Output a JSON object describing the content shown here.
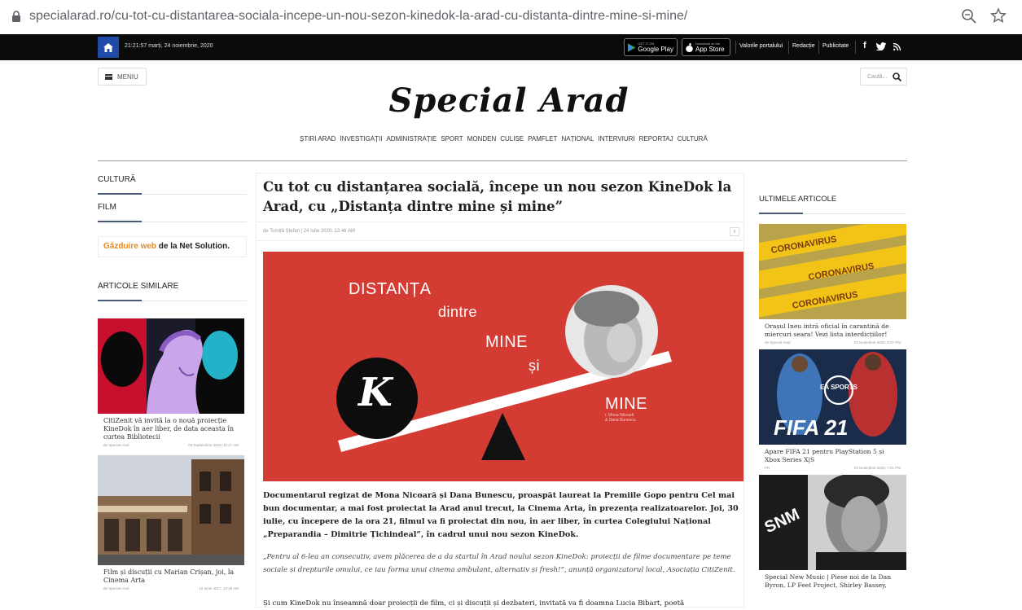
{
  "browser": {
    "url": "specialarad.ro/cu-tot-cu-distantarea-sociala-incepe-un-nou-sezon-kinedok-la-arad-cu-distanta-dintre-mine-si-mine/",
    "icons": [
      "lock-icon",
      "zoom-icon",
      "star-icon"
    ]
  },
  "topbar": {
    "datetime": "21:21:57 marți, 24 noiembrie, 2020",
    "google_play_small": "GET IT ON",
    "google_play": "Google Play",
    "app_store_small": "Download on the",
    "app_store": "App Store",
    "links": [
      "Valorile portalului",
      "Redacție",
      "Publicitate"
    ],
    "social": [
      "facebook-icon",
      "twitter-icon",
      "rss-icon"
    ]
  },
  "header": {
    "menu_label": "MENIU",
    "search_placeholder": "Caută...",
    "logo": "Special Arad",
    "nav": [
      "ȘTIRI ARAD",
      "INVESTIGAȚII",
      "ADMINISTRAȚIE",
      "SPORT",
      "MONDEN",
      "CULISE",
      "PAMFLET",
      "NAȚIONAL",
      "INTERVIURI",
      "REPORTAJ",
      "CULTURĂ"
    ]
  },
  "left": {
    "categories": [
      "CULTURĂ",
      "FILM"
    ],
    "hosting_highlight": "Găzduire web",
    "hosting_rest": " de la Net Solution.",
    "related_title": "ARTICOLE SIMILARE",
    "related": [
      {
        "title": "CitiZenit vă invită la o nouă proiecție KineDok în aer liber, de data aceasta în curtea Bibliotecii",
        "author": "de Special Arad",
        "date": "03 Septembrie 2019, 11:27 AM"
      },
      {
        "title": "Film și discuții cu Marian Crișan, joi, la Cinema Arta",
        "author": "de Special Arad",
        "date": "10 Iunie 2017, 10:28 AM"
      }
    ]
  },
  "article": {
    "title": "Cu tot cu distanțarea socială, începe un nou sezon KineDok la Arad, cu „Distanța dintre mine și mine”",
    "meta": "de Tomiță Ștefan | 24 Iulie 2020, 13:46 AM",
    "comments": "0",
    "hero": {
      "line1": "DISTANȚA",
      "line2": "dintre",
      "line3": "MINE",
      "line4": "și",
      "line5": "MINE",
      "credit1": "r. Mona Nicoară",
      "credit2": "& Dana Bunescu",
      "logo_glyph": "K"
    },
    "p1": "Documentarul regizat de Mona Nicoară și Dana Bunescu, proaspăt laureat la Premiile Gopo pentru Cel mai bun documentar, a mai fost proiectat la Arad anul trecut, la Cinema Arta, în prezența realizatoarelor. Joi, 30 iulie, cu începere de la ora 21, filmul va fi proiectat din nou, în aer liber, în curtea Colegiului Național „Preparandia – Dimitrie Țichindeal”, în cadrul unui nou sezon KineDok.",
    "p2": "„Pentru al 6-lea an consecutiv, avem plăcerea de a da startul în Arad noului sezon KineDok: proiecții de filme documentare pe teme sociale și drepturile omului, ce iau forma unui cinema ambulant, alternativ și fresh!”, anunță organizatorul local, Asociația CitiZenit.",
    "p3": "Și cum KineDok nu înseamnă doar proiecții de film, ci și discuții și dezbateri, invitată va fi doamna Lucia Bibart, poetă"
  },
  "right": {
    "title": "ULTIMELE ARTICOLE",
    "articles": [
      {
        "title": "Orașul Ineu intră oficial în carantină de miercuri seara! Vezi lista interdicțiilor!",
        "author": "de Special Arad",
        "date": "24 Noiembrie 2020, 8:27 PM",
        "thumb_text": "CORONAVIRUS"
      },
      {
        "title": "Apare FIFA 21 pentru PlayStation 5 și Xbox Series X|S",
        "author": "PR",
        "date": "24 Noiembrie 2020, 7:21 PM",
        "thumb_text": "FIFA 21",
        "thumb_badge": "EA SPORTS"
      },
      {
        "title": "Special New Music | Piese noi de la Dan Byron, LP Feet Project, Shirley Bassey,",
        "author": "",
        "date": "",
        "thumb_text": "SNM"
      }
    ]
  },
  "colors": {
    "accent": "#1f4aa8",
    "hero_red": "#d33b33",
    "hosting_orange": "#e58a1f",
    "tape_yellow": "#f2c418"
  }
}
